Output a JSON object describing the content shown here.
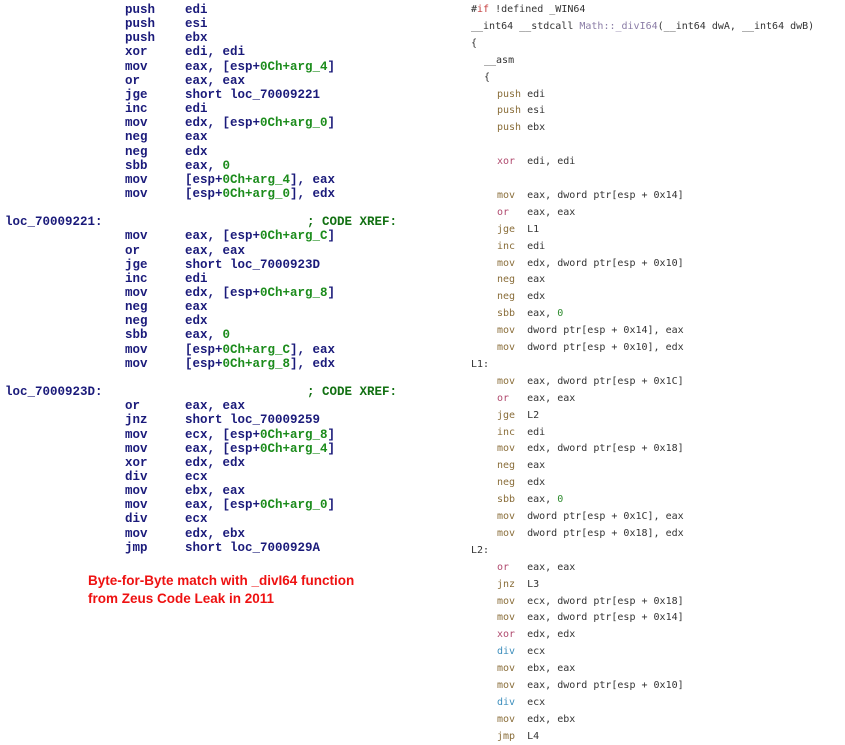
{
  "colors": {
    "ida_text": "#1a1a7a",
    "ida_green": "#1c8c1c",
    "note_red": "#ee1111",
    "mnemonic": "#8a6e3a",
    "logic_op": "#b04a6e",
    "div_op": "#3c8ebc"
  },
  "disassembly": [
    {
      "mn": "push",
      "ops": [
        [
          "edi",
          ""
        ]
      ]
    },
    {
      "mn": "push",
      "ops": [
        [
          "esi",
          ""
        ]
      ]
    },
    {
      "mn": "push",
      "ops": [
        [
          "ebx",
          ""
        ]
      ]
    },
    {
      "mn": "xor",
      "ops": [
        [
          "edi, edi",
          ""
        ]
      ]
    },
    {
      "mn": "mov",
      "ops": [
        [
          "eax, [esp+",
          ""
        ],
        [
          "0Ch+arg_4",
          "g"
        ],
        [
          "]",
          ""
        ]
      ]
    },
    {
      "mn": "or",
      "ops": [
        [
          "eax, eax",
          ""
        ]
      ]
    },
    {
      "mn": "jge",
      "ops": [
        [
          "short loc_70009221",
          ""
        ]
      ]
    },
    {
      "mn": "inc",
      "ops": [
        [
          "edi",
          ""
        ]
      ]
    },
    {
      "mn": "mov",
      "ops": [
        [
          "edx, [esp+",
          ""
        ],
        [
          "0Ch+arg_0",
          "g"
        ],
        [
          "]",
          ""
        ]
      ]
    },
    {
      "mn": "neg",
      "ops": [
        [
          "eax",
          ""
        ]
      ]
    },
    {
      "mn": "neg",
      "ops": [
        [
          "edx",
          ""
        ]
      ]
    },
    {
      "mn": "sbb",
      "ops": [
        [
          "eax, ",
          ""
        ],
        [
          "0",
          "g"
        ]
      ]
    },
    {
      "mn": "mov",
      "ops": [
        [
          "[esp+",
          ""
        ],
        [
          "0Ch+arg_4",
          "g"
        ],
        [
          "], eax",
          ""
        ]
      ]
    },
    {
      "mn": "mov",
      "ops": [
        [
          "[esp+",
          ""
        ],
        [
          "0Ch+arg_0",
          "g"
        ],
        [
          "], edx",
          ""
        ]
      ]
    },
    {},
    {
      "label": "loc_70009221:",
      "comment": "; CODE XREF:"
    },
    {
      "mn": "mov",
      "ops": [
        [
          "eax, [esp+",
          ""
        ],
        [
          "0Ch+arg_C",
          "g"
        ],
        [
          "]",
          ""
        ]
      ]
    },
    {
      "mn": "or",
      "ops": [
        [
          "eax, eax",
          ""
        ]
      ]
    },
    {
      "mn": "jge",
      "ops": [
        [
          "short loc_7000923D",
          ""
        ]
      ]
    },
    {
      "mn": "inc",
      "ops": [
        [
          "edi",
          ""
        ]
      ]
    },
    {
      "mn": "mov",
      "ops": [
        [
          "edx, [esp+",
          ""
        ],
        [
          "0Ch+arg_8",
          "g"
        ],
        [
          "]",
          ""
        ]
      ]
    },
    {
      "mn": "neg",
      "ops": [
        [
          "eax",
          ""
        ]
      ]
    },
    {
      "mn": "neg",
      "ops": [
        [
          "edx",
          ""
        ]
      ]
    },
    {
      "mn": "sbb",
      "ops": [
        [
          "eax, ",
          ""
        ],
        [
          "0",
          "g"
        ]
      ]
    },
    {
      "mn": "mov",
      "ops": [
        [
          "[esp+",
          ""
        ],
        [
          "0Ch+arg_C",
          "g"
        ],
        [
          "], eax",
          ""
        ]
      ]
    },
    {
      "mn": "mov",
      "ops": [
        [
          "[esp+",
          ""
        ],
        [
          "0Ch+arg_8",
          "g"
        ],
        [
          "], edx",
          ""
        ]
      ]
    },
    {},
    {
      "label": "loc_7000923D:",
      "comment": "; CODE XREF:"
    },
    {
      "mn": "or",
      "ops": [
        [
          "eax, eax",
          ""
        ]
      ]
    },
    {
      "mn": "jnz",
      "ops": [
        [
          "short loc_70009259",
          ""
        ]
      ]
    },
    {
      "mn": "mov",
      "ops": [
        [
          "ecx, [esp+",
          ""
        ],
        [
          "0Ch+arg_8",
          "g"
        ],
        [
          "]",
          ""
        ]
      ]
    },
    {
      "mn": "mov",
      "ops": [
        [
          "eax, [esp+",
          ""
        ],
        [
          "0Ch+arg_4",
          "g"
        ],
        [
          "]",
          ""
        ]
      ]
    },
    {
      "mn": "xor",
      "ops": [
        [
          "edx, edx",
          ""
        ]
      ]
    },
    {
      "mn": "div",
      "ops": [
        [
          "ecx",
          ""
        ]
      ]
    },
    {
      "mn": "mov",
      "ops": [
        [
          "ebx, eax",
          ""
        ]
      ]
    },
    {
      "mn": "mov",
      "ops": [
        [
          "eax, [esp+",
          ""
        ],
        [
          "0Ch+arg_0",
          "g"
        ],
        [
          "]",
          ""
        ]
      ]
    },
    {
      "mn": "div",
      "ops": [
        [
          "ecx",
          ""
        ]
      ]
    },
    {
      "mn": "mov",
      "ops": [
        [
          "edx, ebx",
          ""
        ]
      ]
    },
    {
      "mn": "jmp",
      "ops": [
        [
          "short loc_7000929A",
          ""
        ]
      ]
    }
  ],
  "note": {
    "line1": "Byte-for-Byte match with _divI64 function",
    "line2": "from Zeus Code Leak in 2011"
  },
  "source": [
    {
      "indent": 0,
      "tokens": [
        [
          "#",
          "tx"
        ],
        [
          "if",
          "kw"
        ],
        [
          " !defined _WIN64",
          "tx"
        ]
      ]
    },
    {
      "indent": 0,
      "tokens": [
        [
          "__int64 __stdcall ",
          "tx"
        ],
        [
          "Math::_divI64",
          "fn"
        ],
        [
          "(__int64 dwA, __int64 dwB)",
          "tx"
        ]
      ]
    },
    {
      "indent": 0,
      "tokens": [
        [
          "{",
          "tx"
        ]
      ]
    },
    {
      "indent": 1,
      "tokens": [
        [
          "__asm",
          "tx"
        ]
      ]
    },
    {
      "indent": 1,
      "tokens": [
        [
          "{",
          "tx"
        ]
      ]
    },
    {
      "indent": 2,
      "tokens": [
        [
          "push",
          "mn"
        ],
        [
          " edi",
          "tx"
        ]
      ]
    },
    {
      "indent": 2,
      "tokens": [
        [
          "push",
          "mn"
        ],
        [
          " esi",
          "tx"
        ]
      ]
    },
    {
      "indent": 2,
      "tokens": [
        [
          "push",
          "mn"
        ],
        [
          " ebx",
          "tx"
        ]
      ]
    },
    {
      "indent": 2,
      "tokens": []
    },
    {
      "indent": 2,
      "tokens": [
        [
          "xor",
          "lg"
        ],
        [
          "  edi, edi",
          "tx"
        ]
      ]
    },
    {
      "indent": 2,
      "tokens": []
    },
    {
      "indent": 2,
      "tokens": [
        [
          "mov",
          "mn"
        ],
        [
          "  eax, dword ptr[esp + 0x14]",
          "tx"
        ]
      ]
    },
    {
      "indent": 2,
      "tokens": [
        [
          "or",
          "lg"
        ],
        [
          "   eax, eax",
          "tx"
        ]
      ]
    },
    {
      "indent": 2,
      "tokens": [
        [
          "jge",
          "mn"
        ],
        [
          "  L1",
          "tx"
        ]
      ]
    },
    {
      "indent": 2,
      "tokens": [
        [
          "inc",
          "mn"
        ],
        [
          "  edi",
          "tx"
        ]
      ]
    },
    {
      "indent": 2,
      "tokens": [
        [
          "mov",
          "mn"
        ],
        [
          "  edx, dword ptr[esp + 0x10]",
          "tx"
        ]
      ]
    },
    {
      "indent": 2,
      "tokens": [
        [
          "neg",
          "mn"
        ],
        [
          "  eax",
          "tx"
        ]
      ]
    },
    {
      "indent": 2,
      "tokens": [
        [
          "neg",
          "mn"
        ],
        [
          "  edx",
          "tx"
        ]
      ]
    },
    {
      "indent": 2,
      "tokens": [
        [
          "sbb",
          "mn"
        ],
        [
          "  eax, ",
          "tx"
        ],
        [
          "0",
          "num"
        ]
      ]
    },
    {
      "indent": 2,
      "tokens": [
        [
          "mov",
          "mn"
        ],
        [
          "  dword ptr[esp + 0x14], eax",
          "tx"
        ]
      ]
    },
    {
      "indent": 2,
      "tokens": [
        [
          "mov",
          "mn"
        ],
        [
          "  dword ptr[esp + 0x10], edx",
          "tx"
        ]
      ]
    },
    {
      "indent": 0,
      "tokens": [
        [
          "L1:",
          "tx"
        ]
      ]
    },
    {
      "indent": 2,
      "tokens": [
        [
          "mov",
          "mn"
        ],
        [
          "  eax, dword ptr[esp + 0x1C]",
          "tx"
        ]
      ]
    },
    {
      "indent": 2,
      "tokens": [
        [
          "or",
          "lg"
        ],
        [
          "   eax, eax",
          "tx"
        ]
      ]
    },
    {
      "indent": 2,
      "tokens": [
        [
          "jge",
          "mn"
        ],
        [
          "  L2",
          "tx"
        ]
      ]
    },
    {
      "indent": 2,
      "tokens": [
        [
          "inc",
          "mn"
        ],
        [
          "  edi",
          "tx"
        ]
      ]
    },
    {
      "indent": 2,
      "tokens": [
        [
          "mov",
          "mn"
        ],
        [
          "  edx, dword ptr[esp + 0x18]",
          "tx"
        ]
      ]
    },
    {
      "indent": 2,
      "tokens": [
        [
          "neg",
          "mn"
        ],
        [
          "  eax",
          "tx"
        ]
      ]
    },
    {
      "indent": 2,
      "tokens": [
        [
          "neg",
          "mn"
        ],
        [
          "  edx",
          "tx"
        ]
      ]
    },
    {
      "indent": 2,
      "tokens": [
        [
          "sbb",
          "mn"
        ],
        [
          "  eax, ",
          "tx"
        ],
        [
          "0",
          "num"
        ]
      ]
    },
    {
      "indent": 2,
      "tokens": [
        [
          "mov",
          "mn"
        ],
        [
          "  dword ptr[esp + 0x1C], eax",
          "tx"
        ]
      ]
    },
    {
      "indent": 2,
      "tokens": [
        [
          "mov",
          "mn"
        ],
        [
          "  dword ptr[esp + 0x18], edx",
          "tx"
        ]
      ]
    },
    {
      "indent": 0,
      "tokens": [
        [
          "L2:",
          "tx"
        ]
      ]
    },
    {
      "indent": 2,
      "tokens": [
        [
          "or",
          "lg"
        ],
        [
          "   eax, eax",
          "tx"
        ]
      ]
    },
    {
      "indent": 2,
      "tokens": [
        [
          "jnz",
          "mn"
        ],
        [
          "  L3",
          "tx"
        ]
      ]
    },
    {
      "indent": 2,
      "tokens": [
        [
          "mov",
          "mn"
        ],
        [
          "  ecx, dword ptr[esp + 0x18]",
          "tx"
        ]
      ]
    },
    {
      "indent": 2,
      "tokens": [
        [
          "mov",
          "mn"
        ],
        [
          "  eax, dword ptr[esp + 0x14]",
          "tx"
        ]
      ]
    },
    {
      "indent": 2,
      "tokens": [
        [
          "xor",
          "lg"
        ],
        [
          "  edx, edx",
          "tx"
        ]
      ]
    },
    {
      "indent": 2,
      "tokens": [
        [
          "div",
          "dv"
        ],
        [
          "  ecx",
          "tx"
        ]
      ]
    },
    {
      "indent": 2,
      "tokens": [
        [
          "mov",
          "mn"
        ],
        [
          "  ebx, eax",
          "tx"
        ]
      ]
    },
    {
      "indent": 2,
      "tokens": [
        [
          "mov",
          "mn"
        ],
        [
          "  eax, dword ptr[esp + 0x10]",
          "tx"
        ]
      ]
    },
    {
      "indent": 2,
      "tokens": [
        [
          "div",
          "dv"
        ],
        [
          "  ecx",
          "tx"
        ]
      ]
    },
    {
      "indent": 2,
      "tokens": [
        [
          "mov",
          "mn"
        ],
        [
          "  edx, ebx",
          "tx"
        ]
      ]
    },
    {
      "indent": 2,
      "tokens": [
        [
          "jmp",
          "mn"
        ],
        [
          "  L4",
          "tx"
        ]
      ]
    }
  ]
}
